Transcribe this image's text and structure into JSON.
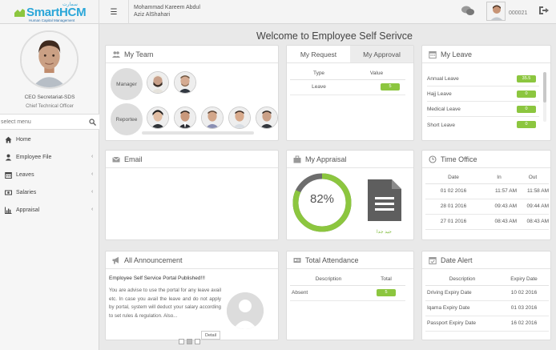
{
  "header": {
    "logo_text": "SmartHCM",
    "logo_subtitle": "Human Capital Management",
    "logo_arabic": "سمارت",
    "user_name_en": "Mohammad Kareem Abdul",
    "user_name_ar": "Aziz AlShahari",
    "employee_id": "000021",
    "menu_icon": "hamburger-icon",
    "chat_icon": "chat-icon",
    "logout_icon": "logout-icon"
  },
  "sidebar": {
    "profile_title": "CEO Secretariat-SDS",
    "profile_role": "Chief Technical Officer",
    "search_placeholder": "select menu",
    "items": [
      {
        "label": "Home",
        "icon": "home-icon"
      },
      {
        "label": "Employee File",
        "icon": "user-icon"
      },
      {
        "label": "Leaves",
        "icon": "calendar-icon"
      },
      {
        "label": "Salaries",
        "icon": "money-icon"
      },
      {
        "label": "Appraisal",
        "icon": "bar-chart-icon"
      }
    ]
  },
  "main": {
    "welcome": "Welcome to Employee Self Serivce",
    "my_team": {
      "title": "My Team",
      "manager_label": "Manager",
      "reportee_label": "Reportee"
    },
    "requests": {
      "tab_request": "My Request",
      "tab_approval": "My Approval",
      "columns": [
        "Type",
        "Value"
      ],
      "rows": [
        {
          "type": "Leave",
          "value": "5"
        }
      ]
    },
    "my_leave": {
      "title": "My Leave",
      "rows": [
        {
          "label": "Annual Leave",
          "value": "35.5"
        },
        {
          "label": "Hajj Leave",
          "value": "0"
        },
        {
          "label": "Medical Leave",
          "value": "0"
        },
        {
          "label": "Short Leave",
          "value": "0"
        }
      ]
    },
    "email": {
      "title": "Email"
    },
    "appraisal": {
      "title": "My Appraisal",
      "percent": "82%",
      "percent_value": 82,
      "doc_caption": "جيد جدا"
    },
    "time_office": {
      "title": "Time Office",
      "columns": [
        "Date",
        "In",
        "Out"
      ],
      "rows": [
        {
          "date": "01 02 2016",
          "in": "11:57 AM",
          "out": "11:58 AM"
        },
        {
          "date": "28 01 2016",
          "in": "09:43 AM",
          "out": "09:44 AM"
        },
        {
          "date": "27 01 2016",
          "in": "08:43 AM",
          "out": "08:43 AM"
        }
      ]
    },
    "announcement": {
      "title": "All Announcement",
      "headline": "Employee Self Service Portal Published!!!",
      "body": "You are advise to use the portal for any leave avail etc. In case you avail the leave and do not apply by portal, system will deduct your salary according to set rules & regulation. Also...",
      "detail_label": "Detail"
    },
    "attendance": {
      "title": "Total Attendance",
      "columns": [
        "Description",
        "Total"
      ],
      "rows": [
        {
          "description": "Absent",
          "total": "5"
        }
      ]
    },
    "date_alert": {
      "title": "Date Alert",
      "columns": [
        "Description",
        "Expiry Date"
      ],
      "rows": [
        {
          "description": "Driving Expiry Date",
          "date": "10 02 2016"
        },
        {
          "description": "Iqama Expiry Date",
          "date": "01 03 2016"
        },
        {
          "description": "Passport Expiry Date",
          "date": "16 02 2016"
        }
      ]
    }
  },
  "colors": {
    "accent": "#8cc63f",
    "brand": "#2aa6d8",
    "ring_track": "#6d6d6d"
  }
}
